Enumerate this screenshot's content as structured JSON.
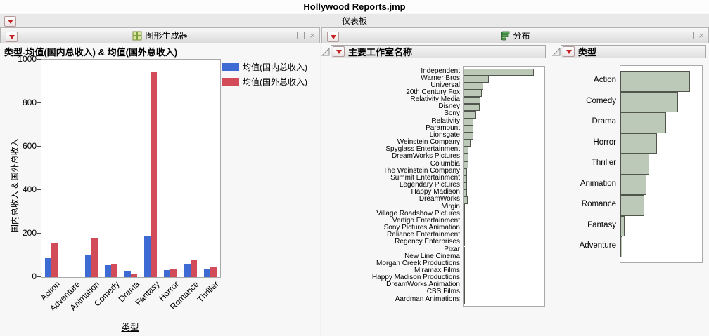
{
  "window_title": "Hollywood Reports.jmp",
  "dashboard": {
    "title": "仪表板"
  },
  "graph_builder": {
    "panel_title": "图形生成器",
    "window_controls": {
      "maximize": "",
      "close": "×"
    }
  },
  "distribution": {
    "panel_title": "分布",
    "window_controls": {
      "maximize": "",
      "close": "×"
    }
  },
  "chart_data": [
    {
      "id": "genre_means",
      "type": "bar",
      "title": "类型-均值(国内总收入) & 均值(国外总收入)",
      "xlabel": "类型",
      "ylabel": "国内总收入 & 国外总收入",
      "ylim": [
        0,
        1000
      ],
      "y_ticks": [
        0,
        200,
        400,
        600,
        800,
        1000
      ],
      "grid": false,
      "legend_position": "right-top",
      "categories": [
        "Action",
        "Adventure",
        "Animation",
        "Comedy",
        "Drama",
        "Fantasy",
        "Horror",
        "Romance",
        "Thriller"
      ],
      "series": [
        {
          "name": "均值(国内总收入)",
          "color": "#3d6bd3",
          "values": [
            88,
            null,
            103,
            54,
            30,
            190,
            33,
            60,
            40
          ]
        },
        {
          "name": "均值(国外总收入)",
          "color": "#d24b58",
          "values": [
            158,
            null,
            180,
            58,
            14,
            945,
            40,
            80,
            47
          ]
        }
      ]
    },
    {
      "id": "studio_distribution",
      "type": "bar",
      "orientation": "horizontal",
      "title": "主要工作室名称",
      "bar_fill": "#bcc9b8",
      "bar_stroke": "#50564c",
      "categories": [
        "Independent",
        "Warner Bros",
        "Universal",
        "20th Century Fox",
        "Relativity Media",
        "Disney",
        "Sony",
        "Relativity",
        "Paramount",
        "Lionsgate",
        "Weinstein Company",
        "Spyglass Entertainment",
        "DreamWorks Pictures",
        "Columbia",
        "The Weinstein Company",
        "Summit Entertainment",
        "Legendary Pictures",
        "Happy Madison",
        "DreamWorks",
        "Virgin",
        "Village Roadshow Pictures",
        "Vertigo Entertainment",
        "Sony Pictures Animation",
        "Reliance Entertainment",
        "Regency Enterprises",
        "Pixar",
        "New Line Cinema",
        "Morgan Creek Productions",
        "Miramax Films",
        "Happy Madison Productions",
        "DreamWorks Animation",
        "CBS Films",
        "Aardman Animations"
      ],
      "relative_lengths": [
        0.87,
        0.31,
        0.24,
        0.23,
        0.21,
        0.2,
        0.155,
        0.12,
        0.12,
        0.12,
        0.09,
        0.065,
        0.065,
        0.065,
        0.042,
        0.042,
        0.042,
        0.042,
        0.048,
        0.02,
        0.014,
        0.014,
        0.014,
        0.014,
        0.014,
        0.014,
        0.014,
        0.014,
        0.014,
        0.014,
        0.014,
        0.014,
        0.014
      ]
    },
    {
      "id": "genre_distribution",
      "type": "bar",
      "orientation": "horizontal",
      "title": "类型",
      "bar_fill": "#bcc9b8",
      "bar_stroke": "#50564c",
      "categories": [
        "Action",
        "Comedy",
        "Drama",
        "Horror",
        "Thriller",
        "Animation",
        "Romance",
        "Fantasy",
        "Adventure"
      ],
      "relative_lengths": [
        0.85,
        0.71,
        0.56,
        0.45,
        0.35,
        0.32,
        0.29,
        0.055,
        0.025
      ]
    }
  ]
}
